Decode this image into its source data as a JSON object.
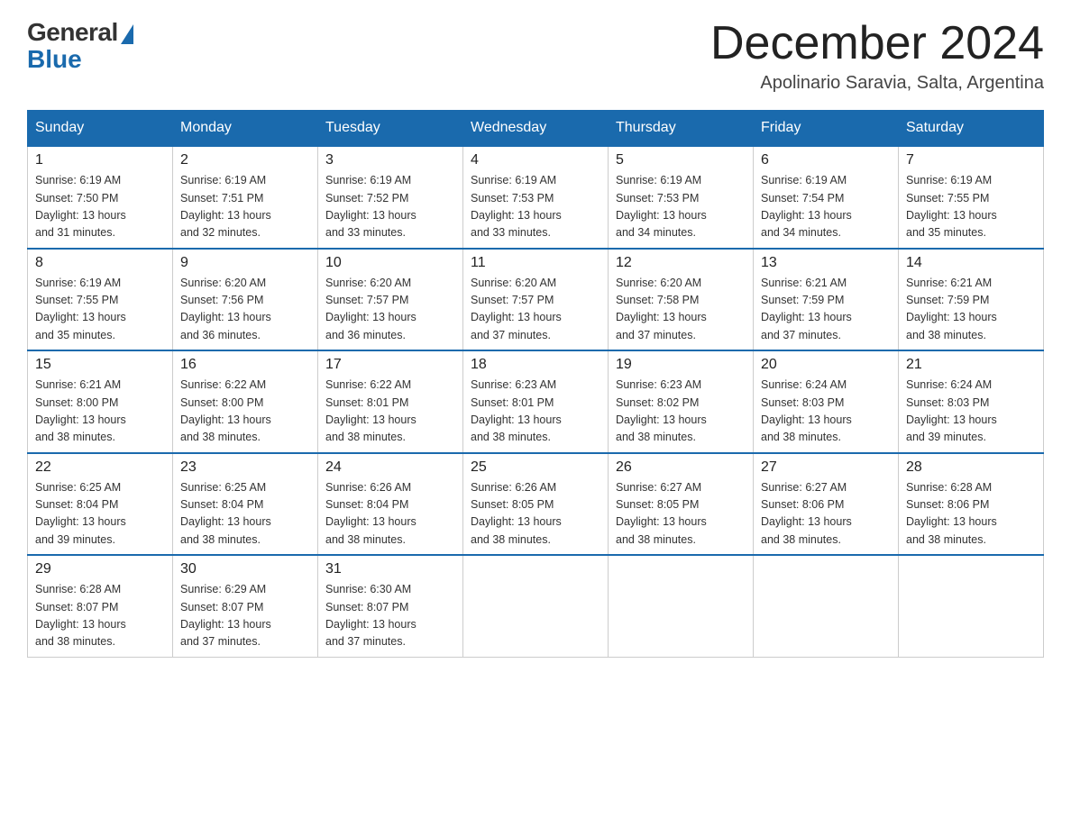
{
  "logo": {
    "general": "General",
    "blue": "Blue"
  },
  "title": "December 2024",
  "subtitle": "Apolinario Saravia, Salta, Argentina",
  "days_of_week": [
    "Sunday",
    "Monday",
    "Tuesday",
    "Wednesday",
    "Thursday",
    "Friday",
    "Saturday"
  ],
  "weeks": [
    [
      {
        "day": "1",
        "sunrise": "6:19 AM",
        "sunset": "7:50 PM",
        "daylight": "13 hours and 31 minutes."
      },
      {
        "day": "2",
        "sunrise": "6:19 AM",
        "sunset": "7:51 PM",
        "daylight": "13 hours and 32 minutes."
      },
      {
        "day": "3",
        "sunrise": "6:19 AM",
        "sunset": "7:52 PM",
        "daylight": "13 hours and 33 minutes."
      },
      {
        "day": "4",
        "sunrise": "6:19 AM",
        "sunset": "7:53 PM",
        "daylight": "13 hours and 33 minutes."
      },
      {
        "day": "5",
        "sunrise": "6:19 AM",
        "sunset": "7:53 PM",
        "daylight": "13 hours and 34 minutes."
      },
      {
        "day": "6",
        "sunrise": "6:19 AM",
        "sunset": "7:54 PM",
        "daylight": "13 hours and 34 minutes."
      },
      {
        "day": "7",
        "sunrise": "6:19 AM",
        "sunset": "7:55 PM",
        "daylight": "13 hours and 35 minutes."
      }
    ],
    [
      {
        "day": "8",
        "sunrise": "6:19 AM",
        "sunset": "7:55 PM",
        "daylight": "13 hours and 35 minutes."
      },
      {
        "day": "9",
        "sunrise": "6:20 AM",
        "sunset": "7:56 PM",
        "daylight": "13 hours and 36 minutes."
      },
      {
        "day": "10",
        "sunrise": "6:20 AM",
        "sunset": "7:57 PM",
        "daylight": "13 hours and 36 minutes."
      },
      {
        "day": "11",
        "sunrise": "6:20 AM",
        "sunset": "7:57 PM",
        "daylight": "13 hours and 37 minutes."
      },
      {
        "day": "12",
        "sunrise": "6:20 AM",
        "sunset": "7:58 PM",
        "daylight": "13 hours and 37 minutes."
      },
      {
        "day": "13",
        "sunrise": "6:21 AM",
        "sunset": "7:59 PM",
        "daylight": "13 hours and 37 minutes."
      },
      {
        "day": "14",
        "sunrise": "6:21 AM",
        "sunset": "7:59 PM",
        "daylight": "13 hours and 38 minutes."
      }
    ],
    [
      {
        "day": "15",
        "sunrise": "6:21 AM",
        "sunset": "8:00 PM",
        "daylight": "13 hours and 38 minutes."
      },
      {
        "day": "16",
        "sunrise": "6:22 AM",
        "sunset": "8:00 PM",
        "daylight": "13 hours and 38 minutes."
      },
      {
        "day": "17",
        "sunrise": "6:22 AM",
        "sunset": "8:01 PM",
        "daylight": "13 hours and 38 minutes."
      },
      {
        "day": "18",
        "sunrise": "6:23 AM",
        "sunset": "8:01 PM",
        "daylight": "13 hours and 38 minutes."
      },
      {
        "day": "19",
        "sunrise": "6:23 AM",
        "sunset": "8:02 PM",
        "daylight": "13 hours and 38 minutes."
      },
      {
        "day": "20",
        "sunrise": "6:24 AM",
        "sunset": "8:03 PM",
        "daylight": "13 hours and 38 minutes."
      },
      {
        "day": "21",
        "sunrise": "6:24 AM",
        "sunset": "8:03 PM",
        "daylight": "13 hours and 39 minutes."
      }
    ],
    [
      {
        "day": "22",
        "sunrise": "6:25 AM",
        "sunset": "8:04 PM",
        "daylight": "13 hours and 39 minutes."
      },
      {
        "day": "23",
        "sunrise": "6:25 AM",
        "sunset": "8:04 PM",
        "daylight": "13 hours and 38 minutes."
      },
      {
        "day": "24",
        "sunrise": "6:26 AM",
        "sunset": "8:04 PM",
        "daylight": "13 hours and 38 minutes."
      },
      {
        "day": "25",
        "sunrise": "6:26 AM",
        "sunset": "8:05 PM",
        "daylight": "13 hours and 38 minutes."
      },
      {
        "day": "26",
        "sunrise": "6:27 AM",
        "sunset": "8:05 PM",
        "daylight": "13 hours and 38 minutes."
      },
      {
        "day": "27",
        "sunrise": "6:27 AM",
        "sunset": "8:06 PM",
        "daylight": "13 hours and 38 minutes."
      },
      {
        "day": "28",
        "sunrise": "6:28 AM",
        "sunset": "8:06 PM",
        "daylight": "13 hours and 38 minutes."
      }
    ],
    [
      {
        "day": "29",
        "sunrise": "6:28 AM",
        "sunset": "8:07 PM",
        "daylight": "13 hours and 38 minutes."
      },
      {
        "day": "30",
        "sunrise": "6:29 AM",
        "sunset": "8:07 PM",
        "daylight": "13 hours and 37 minutes."
      },
      {
        "day": "31",
        "sunrise": "6:30 AM",
        "sunset": "8:07 PM",
        "daylight": "13 hours and 37 minutes."
      },
      null,
      null,
      null,
      null
    ]
  ],
  "labels": {
    "sunrise": "Sunrise:",
    "sunset": "Sunset:",
    "daylight": "Daylight:"
  }
}
